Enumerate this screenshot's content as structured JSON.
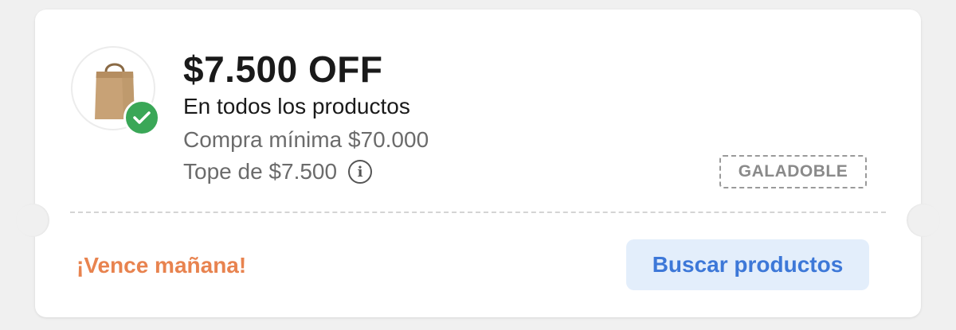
{
  "coupon": {
    "title": "$7.500 OFF",
    "subtitle": "En todos los productos",
    "minimum_purchase": "Compra mínima $70.000",
    "cap": "Tope de $7.500",
    "code": "GALADOBLE",
    "expiry": "¡Vence mañana!",
    "action_label": "Buscar productos",
    "icons": [
      "paper-bag-icon",
      "check-badge-icon",
      "info-icon"
    ],
    "colors": {
      "check_badge": "#3aa757",
      "expiry_text": "#e8834f",
      "button_bg": "#e3eefb",
      "button_text": "#3d78d8"
    }
  }
}
